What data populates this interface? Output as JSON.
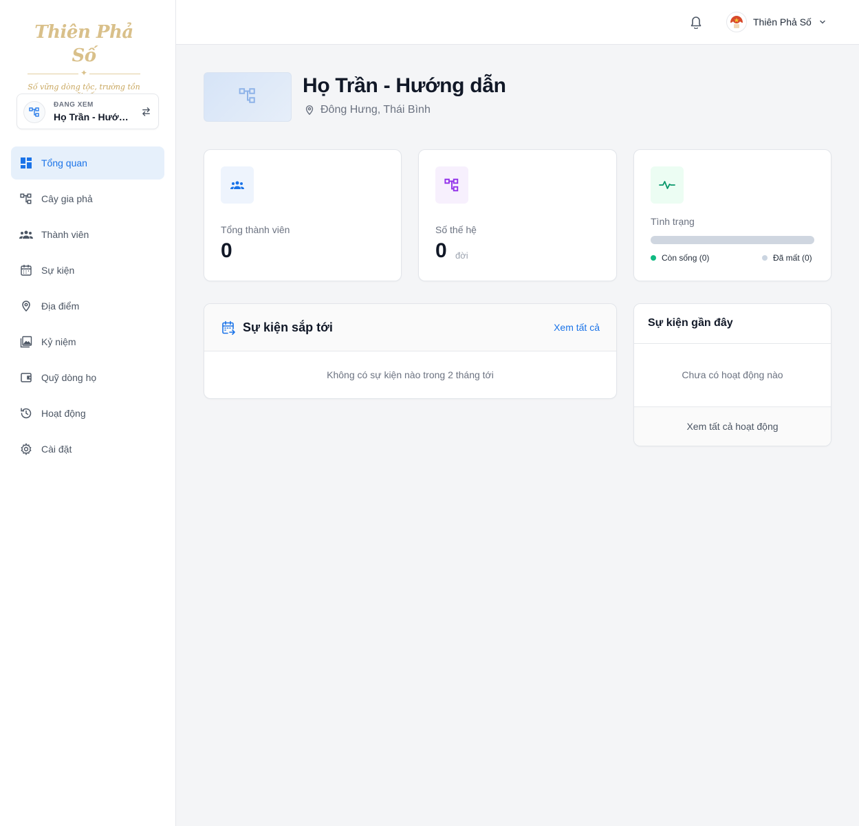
{
  "brand": {
    "logo_text": "Thiên Phả Số",
    "tagline": "Số vững dòng tộc, trường tồn cõi số."
  },
  "sidebar": {
    "viewing_label": "ĐANG XEM",
    "viewing_name": "Họ Trần - Hướng dẫn",
    "items": [
      {
        "label": "Tổng quan",
        "icon": "dashboard-icon",
        "active": true
      },
      {
        "label": "Cây gia phả",
        "icon": "family-tree-icon"
      },
      {
        "label": "Thành viên",
        "icon": "members-icon"
      },
      {
        "label": "Sự kiện",
        "icon": "calendar-icon"
      },
      {
        "label": "Địa điểm",
        "icon": "location-pin-icon"
      },
      {
        "label": "Kỷ niệm",
        "icon": "photo-album-icon"
      },
      {
        "label": "Quỹ dòng họ",
        "icon": "wallet-icon"
      },
      {
        "label": "Hoạt động",
        "icon": "history-icon"
      },
      {
        "label": "Cài đặt",
        "icon": "gear-icon"
      }
    ]
  },
  "topbar": {
    "user_name": "Thiên Phả Số"
  },
  "header": {
    "title": "Họ Trần - Hướng dẫn",
    "location": "Đông Hưng, Thái Bình"
  },
  "stats": {
    "members": {
      "label": "Tổng thành viên",
      "value": "0"
    },
    "generations": {
      "label": "Số thế hệ",
      "value": "0",
      "unit": "đời"
    },
    "status": {
      "label": "Tình trạng",
      "alive": "Còn sống (0)",
      "deceased": "Đã mất (0)",
      "alive_count": 0,
      "deceased_count": 0
    }
  },
  "upcoming": {
    "title": "Sự kiện sắp tới",
    "link": "Xem tất cả",
    "empty": "Không có sự kiện nào trong 2 tháng tới"
  },
  "recent": {
    "title": "Sự kiện gần đây",
    "empty": "Chưa có hoạt động nào",
    "footer_link": "Xem tất cả hoạt động"
  },
  "colors": {
    "accent": "#1a73e8",
    "active_bg": "#e6f0fb",
    "alive": "#10b981",
    "deceased": "#cbd5e1",
    "generation_purple": "#9333ea",
    "status_green": "#059669",
    "brand_gold": "#d9c08a"
  }
}
